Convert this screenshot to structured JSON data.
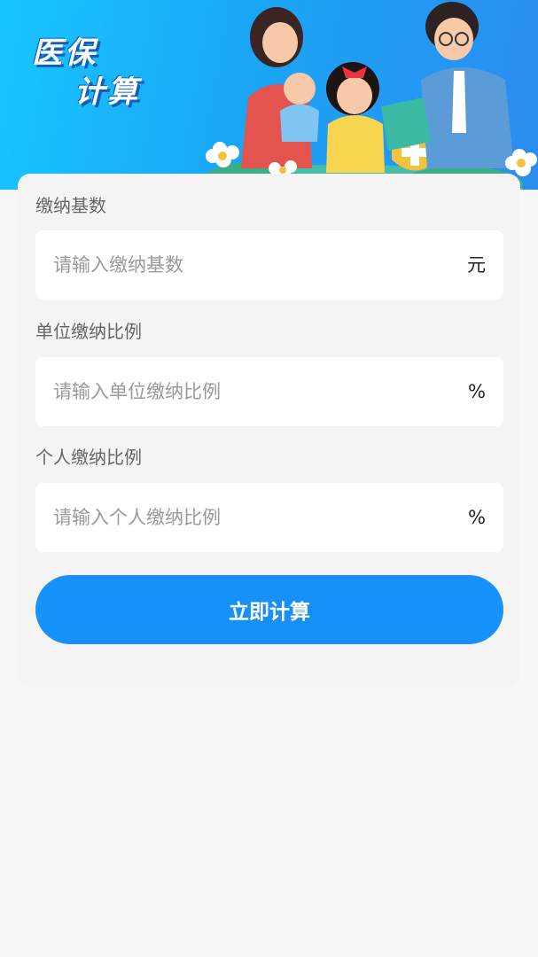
{
  "banner": {
    "title_line1": "医保",
    "title_line2": "计算",
    "colors": {
      "gradient_start": "#18c6ff",
      "gradient_end": "#2b8cf0"
    }
  },
  "form": {
    "base": {
      "label": "缴纳基数",
      "placeholder": "请输入缴纳基数",
      "value": "",
      "unit": "元"
    },
    "company_ratio": {
      "label": "单位缴纳比例",
      "placeholder": "请输入单位缴纳比例",
      "value": "",
      "unit": "%"
    },
    "personal_ratio": {
      "label": "个人缴纳比例",
      "placeholder": "请输入个人缴纳比例",
      "value": "",
      "unit": "%"
    }
  },
  "actions": {
    "calculate_label": "立即计算",
    "accent_color": "#1890f9"
  }
}
